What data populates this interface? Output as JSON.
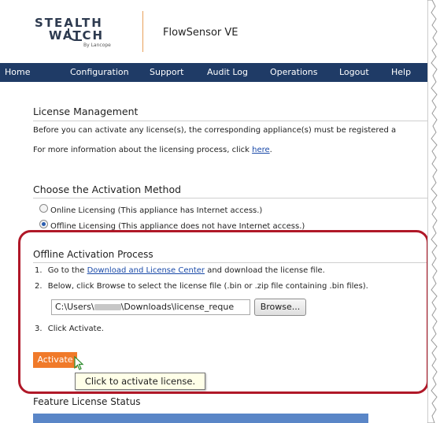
{
  "header": {
    "logo_line1": "STEALTH",
    "logo_line2": "WATCH",
    "logo_line3": "By Lancope",
    "product_name": "FlowSensor VE"
  },
  "nav": {
    "items": [
      "Home",
      "Configuration",
      "Support",
      "Audit Log",
      "Operations",
      "Logout",
      "Help"
    ]
  },
  "license_management": {
    "heading": "License Management",
    "line1": "Before you can activate any license(s), the corresponding appliance(s) must be registered a",
    "line2_prefix": "For more information about the licensing process, click ",
    "line2_link": "here",
    "line2_suffix": "."
  },
  "activation_method": {
    "heading": "Choose the Activation Method",
    "options": [
      {
        "label": "Online Licensing (This appliance has Internet access.)",
        "selected": false
      },
      {
        "label": "Offline Licensing (This appliance does not have Internet access.)",
        "selected": true
      }
    ]
  },
  "offline_process": {
    "heading": "Offline Activation Process",
    "step1_num": "1.",
    "step1_prefix": "Go to the ",
    "step1_link": "Download and License Center",
    "step1_suffix": " and download the license file.",
    "step2_num": "2.",
    "step2_text": "Below, click Browse to select the license file (.bin or .zip file containing .bin files).",
    "file_path_prefix": "C:\\Users\\",
    "file_path_suffix": "\\Downloads\\license_reque",
    "browse_label": "Browse...",
    "step3_num": "3.",
    "step3_text": "Click Activate."
  },
  "activate_button": "Activate",
  "tooltip": "Click to activate license.",
  "feature_status": {
    "heading": "Feature License Status"
  },
  "colors": {
    "nav_bg": "#1f3b66",
    "accent_orange": "#f07a2a",
    "callout_red": "#b01828",
    "link_blue": "#1a4aa8"
  }
}
